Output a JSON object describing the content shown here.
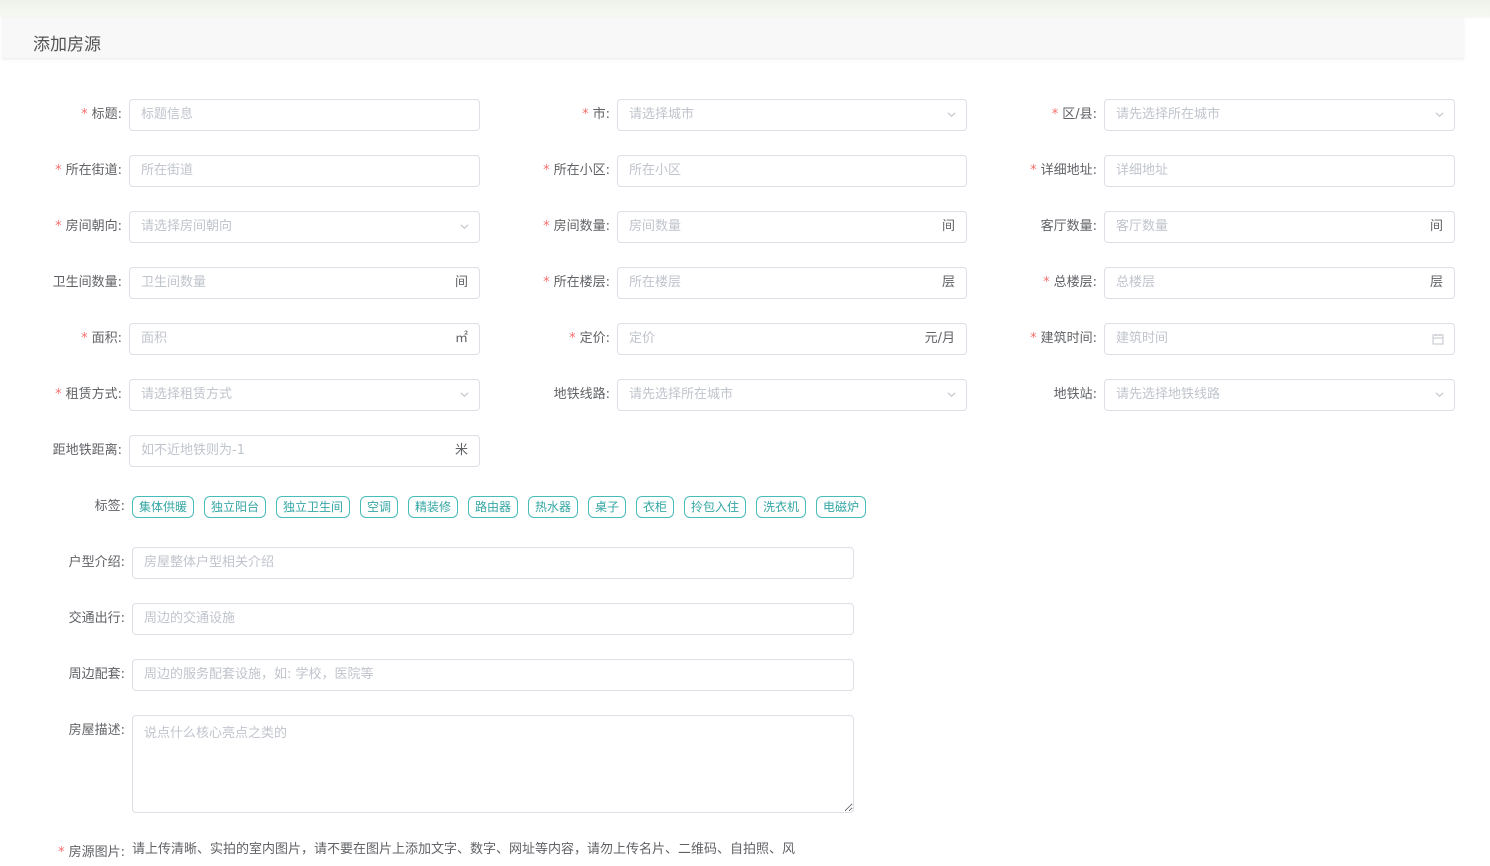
{
  "page_title": "添加房源",
  "required_mark": "*",
  "fields": {
    "title": {
      "label": "标题:",
      "placeholder": "标题信息"
    },
    "city": {
      "label": "市:",
      "placeholder": "请选择城市"
    },
    "district": {
      "label": "区/县:",
      "placeholder": "请先选择所在城市"
    },
    "street": {
      "label": "所在街道:",
      "placeholder": "所在街道"
    },
    "community": {
      "label": "所在小区:",
      "placeholder": "所在小区"
    },
    "address": {
      "label": "详细地址:",
      "placeholder": "详细地址"
    },
    "orientation": {
      "label": "房间朝向:",
      "placeholder": "请选择房间朝向"
    },
    "rooms": {
      "label": "房间数量:",
      "placeholder": "房间数量",
      "suffix": "间"
    },
    "halls": {
      "label": "客厅数量:",
      "placeholder": "客厅数量",
      "suffix": "间"
    },
    "bathrooms": {
      "label": "卫生间数量:",
      "placeholder": "卫生间数量",
      "suffix": "间"
    },
    "floor": {
      "label": "所在楼层:",
      "placeholder": "所在楼层",
      "suffix": "层"
    },
    "total_floors": {
      "label": "总楼层:",
      "placeholder": "总楼层",
      "suffix": "层"
    },
    "area": {
      "label": "面积:",
      "placeholder": "面积",
      "suffix": "㎡"
    },
    "price": {
      "label": "定价:",
      "placeholder": "定价",
      "suffix": "元/月"
    },
    "build_time": {
      "label": "建筑时间:",
      "placeholder": "建筑时间"
    },
    "rent_type": {
      "label": "租赁方式:",
      "placeholder": "请选择租赁方式"
    },
    "subway_line": {
      "label": "地铁线路:",
      "placeholder": "请先选择所在城市"
    },
    "subway_station": {
      "label": "地铁站:",
      "placeholder": "请先选择地铁线路"
    },
    "subway_distance": {
      "label": "距地铁距离:",
      "placeholder": "如不近地铁则为-1",
      "suffix": "米"
    }
  },
  "tags": {
    "label": "标签:",
    "items": [
      "集体供暖",
      "独立阳台",
      "独立卫生间",
      "空调",
      "精装修",
      "路由器",
      "热水器",
      "桌子",
      "衣柜",
      "拎包入住",
      "洗衣机",
      "电磁炉"
    ]
  },
  "layout_intro": {
    "label": "户型介绍:",
    "placeholder": "房屋整体户型相关介绍"
  },
  "traffic": {
    "label": "交通出行:",
    "placeholder": "周边的交通设施"
  },
  "surroundings": {
    "label": "周边配套:",
    "placeholder": "周边的服务配套设施，如: 学校，医院等"
  },
  "description": {
    "label": "房屋描述:",
    "placeholder": "说点什么核心亮点之类的"
  },
  "photos": {
    "label": "房源图片:",
    "hint": "请上传清晰、实拍的室内图片，请不要在图片上添加文字、数字、网址等内容，请勿上传名片、二维码、自拍照、风"
  },
  "colors": {
    "required": "#f56c6c",
    "tag_border": "#48bcb9",
    "tag_text": "#34a6a3"
  }
}
